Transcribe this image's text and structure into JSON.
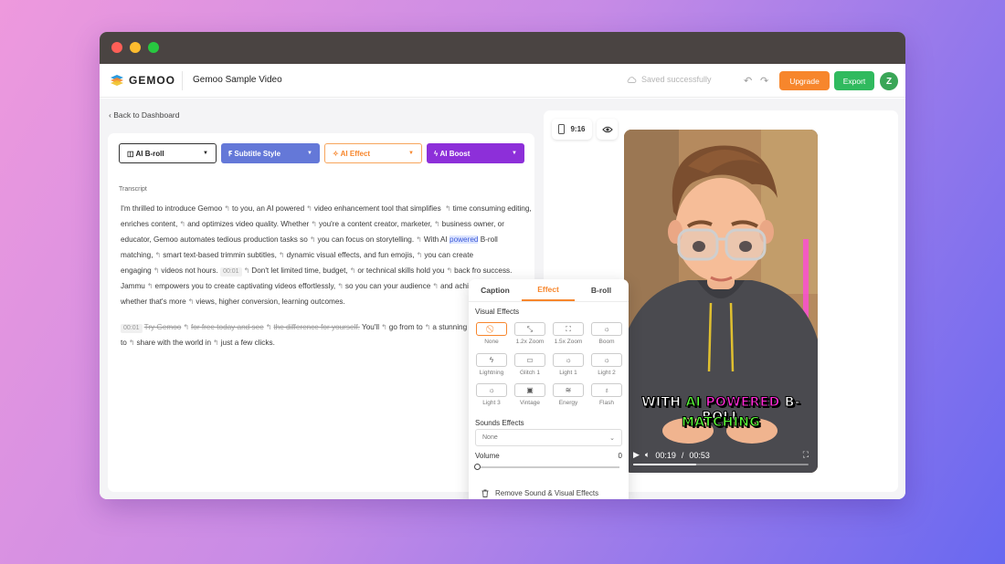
{
  "app": {
    "name": "GEMOO",
    "project_title": "Gemoo Sample Video",
    "saved_status": "Saved successfully",
    "upgrade_label": "Upgrade",
    "export_label": "Export",
    "avatar_letter": "Z",
    "colors": {
      "upgrade": "#f7862c",
      "export": "#30ba5e",
      "accent": "#f7862c"
    }
  },
  "nav": {
    "back_label": "Back to Dashboard"
  },
  "toolbar": {
    "broll": {
      "label": "AI B-roll",
      "icon": "image-icon"
    },
    "subtitle": {
      "label": "Subtitle Style",
      "icon": "text-style-icon",
      "color": "#6478d8"
    },
    "effect": {
      "label": "AI Effect",
      "icon": "sparkle-icon",
      "color": "#f7862c"
    },
    "boost": {
      "label": "AI Boost",
      "icon": "bolt-icon",
      "color": "#8d2fd9"
    }
  },
  "transcript": {
    "label": "Transcript",
    "p1": {
      "s1": "I'm thrilled to introduce Gemoo",
      "s2": "to you, an AI powered",
      "s3": "video enhancement tool that simplifies",
      "s4": "time consuming editing, enriches content,",
      "s5": "and optimizes video quality. Whether",
      "s6": "you're a content creator, marketer,",
      "s7": "business owner, or educator, Gemoo automates tedious production tasks so",
      "s8": "you can focus on storytelling.",
      "s9a": "With AI",
      "s9b": "powered",
      "s9c": "B-roll matching,",
      "s10": "smart text-based trimmin",
      "s11": "subtitles,",
      "s12": "dynamic visual effects, and fun emojis,",
      "s13": "you can create engaging",
      "s14": "videos",
      "s15": "not hours.",
      "ts1": "00:01",
      "s16": "Don't let limited time, budget,",
      "s17": "or technical skills hold you",
      "s18": "back fro",
      "s19": "success. Jammu",
      "s20": "empowers you to create captivating videos effortlessly,",
      "s21": "so you can",
      "s22": "your audience",
      "s23": "and achieve your goals, whether that's more",
      "s24": "views, higher conversion,",
      "s25": "learning outcomes."
    },
    "p2": {
      "ts": "00:01",
      "s1": "Try Gemoo",
      "s2": "for free today and see",
      "s3": "the difference for yourself.",
      "s4": "You'll",
      "s5": "go from",
      "s6": "to",
      "s7": "a stunning video ready to",
      "s8": "share with the world in",
      "s9": "just a few clicks."
    }
  },
  "preview": {
    "ratio": "9:16",
    "caption_line1": {
      "w1": "WITH",
      "w2": "AI",
      "w3": "POWERED",
      "w4": "B-ROLL"
    },
    "caption_line2": "MATCHING",
    "caption_colors": {
      "white": "#ffffff",
      "green": "#5cff3a",
      "pink": "#ff2bd6"
    },
    "current_time": "00:19",
    "time_sep": "/",
    "duration": "00:53",
    "progress": 0.36
  },
  "effects_panel": {
    "tabs": [
      {
        "label": "Caption"
      },
      {
        "label": "Effect"
      },
      {
        "label": "B-roll"
      }
    ],
    "active_tab": "Effect",
    "visual_effects_label": "Visual Effects",
    "effects": [
      {
        "label": "None",
        "icon": "none-icon",
        "glyph": "⃠"
      },
      {
        "label": "1.2x Zoom",
        "icon": "zoom-in-icon",
        "glyph": "⤡"
      },
      {
        "label": "1.5x Zoom",
        "icon": "zoom-expand-icon",
        "glyph": "⛶"
      },
      {
        "label": "Boom",
        "icon": "sun-icon",
        "glyph": "☼"
      },
      {
        "label": "Lightning",
        "icon": "lightning-icon",
        "glyph": "ϟ"
      },
      {
        "label": "Glitch 1",
        "icon": "glitch-icon",
        "glyph": "▭"
      },
      {
        "label": "Light 1",
        "icon": "light-icon",
        "glyph": "☼"
      },
      {
        "label": "Light 2",
        "icon": "light-icon",
        "glyph": "☼"
      },
      {
        "label": "Light 3",
        "icon": "light-icon",
        "glyph": "☼"
      },
      {
        "label": "Vintage",
        "icon": "film-icon",
        "glyph": "▣"
      },
      {
        "label": "Energy",
        "icon": "energy-icon",
        "glyph": "≋"
      },
      {
        "label": "Flash",
        "icon": "flash-bulb-icon",
        "glyph": "♁"
      }
    ],
    "sounds_label": "Sounds Effects",
    "sound_value": "None",
    "volume_label": "Volume",
    "volume_value": "0",
    "remove_label": "Remove Sound & Visual Effects"
  }
}
